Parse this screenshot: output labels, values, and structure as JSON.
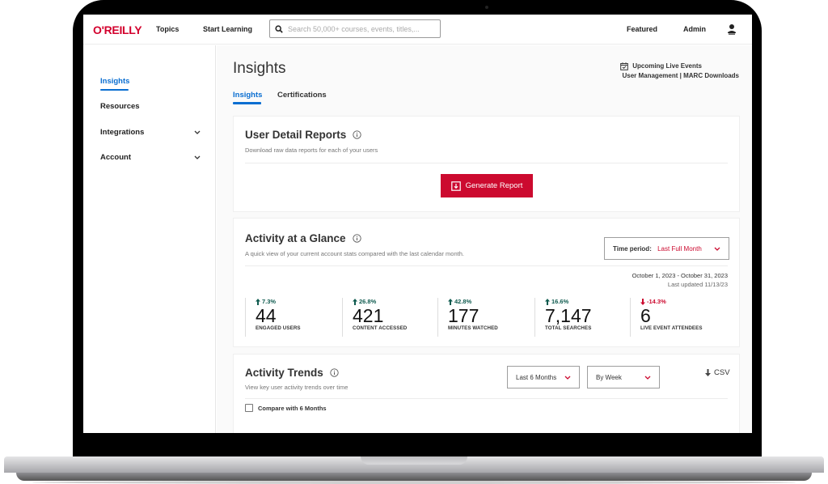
{
  "topnav": {
    "logo": "O'REILLY",
    "links": [
      "Topics",
      "Start Learning"
    ],
    "search_placeholder": "Search 50,000+ courses, events, titles,...",
    "right_links": [
      "Featured",
      "Admin"
    ],
    "brand_color": "#d3002d"
  },
  "sidebar": {
    "items": [
      {
        "label": "Insights",
        "active": true,
        "expandable": false
      },
      {
        "label": "Resources",
        "active": false,
        "expandable": false
      },
      {
        "label": "Integrations",
        "active": false,
        "expandable": true
      },
      {
        "label": "Account",
        "active": false,
        "expandable": true
      }
    ]
  },
  "main": {
    "title": "Insights",
    "tabs": [
      {
        "label": "Insights",
        "active": true
      },
      {
        "label": "Certifications",
        "active": false
      }
    ],
    "right_links": {
      "upcoming": "Upcoming Live Events",
      "user_management": "User Management",
      "separator": "|",
      "marc": "MARC Downloads"
    },
    "user_detail_reports": {
      "title": "User Detail Reports",
      "subtitle": "Download raw data reports for each of your users",
      "button": "Generate Report"
    },
    "activity_glance": {
      "title": "Activity at a Glance",
      "subtitle": "A quick view of your current account stats compared with the last calendar month.",
      "time_period_label": "Time period:",
      "time_period_value": "Last Full Month",
      "date_range": "October 1, 2023 - October 31, 2023",
      "last_updated": "Last updated 11/13/23",
      "stats": [
        {
          "change": "7.3%",
          "direction": "up",
          "value": "44",
          "label": "ENGAGED USERS"
        },
        {
          "change": "26.8%",
          "direction": "up",
          "value": "421",
          "label": "CONTENT ACCESSED"
        },
        {
          "change": "42.8%",
          "direction": "up",
          "value": "177",
          "label": "MINUTES WATCHED"
        },
        {
          "change": "16.6%",
          "direction": "up",
          "value": "7,147",
          "label": "TOTAL SEARCHES"
        },
        {
          "change": "-14.3%",
          "direction": "down",
          "value": "6",
          "label": "LIVE EVENT ATTENDEES"
        }
      ]
    },
    "activity_trends": {
      "title": "Activity Trends",
      "subtitle": "View key user activity trends over time",
      "range_select": "Last 6 Months",
      "interval_select": "By Week",
      "csv_label": "CSV",
      "compare_label": "Compare with 6 Months",
      "compare_checked": false
    }
  },
  "colors": {
    "accent_blue": "#0a6ed1",
    "primary_red": "#cc0a2f",
    "positive_green": "#0f5b4f"
  }
}
